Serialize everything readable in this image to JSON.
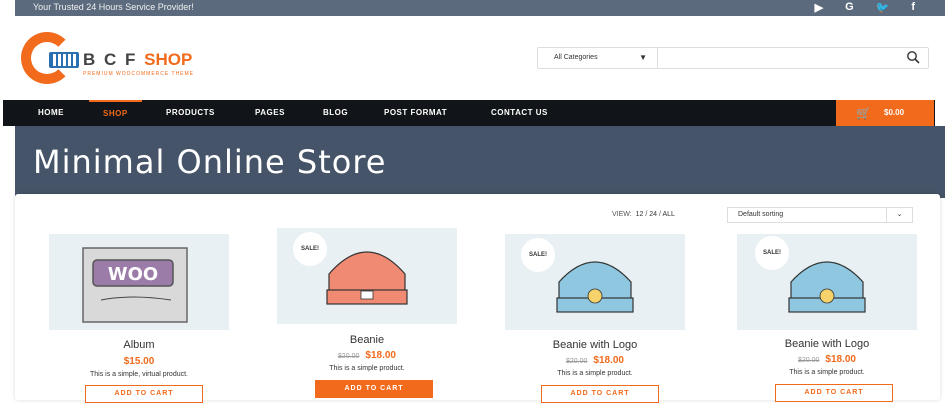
{
  "topbar": {
    "tagline": "Your Trusted 24 Hours Service Provider!",
    "social": [
      "youtube-icon",
      "google-icon",
      "twitter-icon",
      "facebook-icon"
    ]
  },
  "logo": {
    "name": "B C F",
    "shop": "SHOP",
    "tagline": "PREMIUM WOOCOMMERCE THEME"
  },
  "search": {
    "category": "All Categories",
    "placeholder": "",
    "value": ""
  },
  "nav": {
    "items": [
      "HOME",
      "SHOP",
      "PRODUCTS",
      "PAGES",
      "BLOG",
      "POST FORMAT",
      "CONTACT US"
    ],
    "active": "SHOP",
    "cart_total": "$0.00"
  },
  "hero": {
    "title": "Minimal Online Store"
  },
  "toolbar": {
    "view_label": "VIEW:",
    "view_options": [
      "12",
      "24",
      "ALL"
    ],
    "sort_value": "Default sorting"
  },
  "products": [
    {
      "title": "Album",
      "old_price": "",
      "price": "$15.00",
      "desc": "This is a simple, virtual product.",
      "sale": false,
      "button": "ADD TO CART",
      "image": "woo-album"
    },
    {
      "title": "Beanie",
      "old_price": "$20.00",
      "price": "$18.00",
      "desc": "This is a simple product.",
      "sale": true,
      "sale_label": "SALE!",
      "button": "ADD TO CART",
      "image": "orange-beanie"
    },
    {
      "title": "Beanie with Logo",
      "old_price": "$20.00",
      "price": "$18.00",
      "desc": "This is a simple product.",
      "sale": true,
      "sale_label": "SALE!",
      "button": "ADD TO CART",
      "image": "blue-beanie"
    },
    {
      "title": "Beanie with Logo",
      "old_price": "$20.00",
      "price": "$18.00",
      "desc": "This is a simple product.",
      "sale": true,
      "sale_label": "SALE!",
      "button": "ADD TO CART",
      "image": "blue-beanie"
    }
  ],
  "colors": {
    "accent": "#f26a1b",
    "nav_bg": "#111418",
    "hero_bg": "#455468",
    "topbar_bg": "#5b6b7d"
  }
}
